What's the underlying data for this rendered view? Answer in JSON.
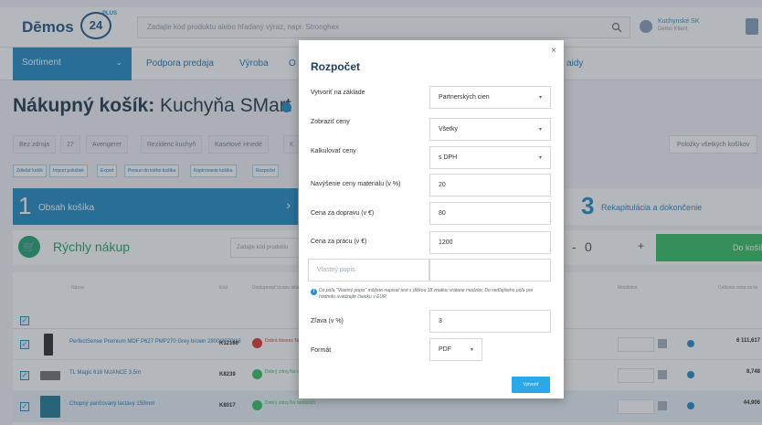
{
  "header": {
    "logo_text": "Dēmos",
    "logo_badge": "24",
    "logo_plus": "PLUS",
    "search_placeholder": "Zadajte kód produktu alebo hľadaný výraz, napr. Stronghex",
    "account_name": "Kuchynské SK",
    "account_sub": "Demo Klient"
  },
  "nav": {
    "sortiment": "Sortiment",
    "items": [
      "Podpora predaja",
      "Výroba",
      "O",
      "aidy"
    ]
  },
  "page": {
    "title_bold": "Nákupný košík:",
    "title_rest": " Kuchyňa SMart"
  },
  "toolbar": {
    "buttons": [
      "Bez zdroja",
      "27",
      "Avengerer",
      "Rezidenc kuchyň",
      "Kasetové Hnedé",
      "K"
    ],
    "right_button": "Položky všetkých košíkov",
    "tags": [
      "Zdieľať košík",
      "Import položiek",
      "Export",
      "Presun do iného košíka",
      "Kopírovanie košíka",
      "Rozpočet"
    ]
  },
  "steps": {
    "step1_num": "1",
    "step1_label": "Obsah košíka",
    "step3_num": "3",
    "step3_label": "Rekapitulácia a dokončenie"
  },
  "quick": {
    "label": "Rýchly nákup",
    "placeholder": "Zadajte kód produktu",
    "qty": "0",
    "add_label": "Do košíka"
  },
  "table": {
    "headers": [
      "Názov",
      "Kód",
      "Dostupnosť tovaru skladu",
      "Množstvo",
      "Celková cena za ks"
    ],
    "rows": [
      {
        "name": "PerfectSense Premium MDF P627 PMP270 Grey brown 2800/2070/18",
        "code": "K12180",
        "stock": "Dobrá štvorec Na požiadanie",
        "price": "6 111,617"
      },
      {
        "name": "TL Magic 618 NUANCE 3,5m",
        "code": "K8239",
        "stock": "Dobrý zdroj Na rastúcich",
        "price": "8,748"
      },
      {
        "name": "Chopný pančovaný lactavý 150mm",
        "code": "K8017",
        "stock": "Dobrý zdroj Na rastúcich",
        "price": "44,906"
      }
    ]
  },
  "modal": {
    "title": "Rozpočet",
    "close": "×",
    "fields": [
      {
        "label": "Vytvoriť na základe",
        "value": "Partnerských cien"
      },
      {
        "label": "Zobraziť ceny",
        "value": "Všetky"
      },
      {
        "label": "Kalkulovať ceny",
        "value": "s DPH"
      },
      {
        "label": "Navýšenie ceny materiálu (v %)",
        "value": "20"
      },
      {
        "label": "Cena za dopravu (v €)",
        "value": "80"
      },
      {
        "label": "Cena za prácu (v €)",
        "value": "1200"
      }
    ],
    "custom_placeholder": "Vlastný popis",
    "note": "Do poľa \"Vlastný popis\" môžete napísať text s dĺžkou 18 znakov vrátane medzier. Do vedľajšieho poľa pre hodnotu uvádzajte čiastku v EUR.",
    "discount_label": "Zľava (v %)",
    "discount_value": "3",
    "format_label": "Formát",
    "format_value": "PDF",
    "submit": "Vytvoriť"
  }
}
